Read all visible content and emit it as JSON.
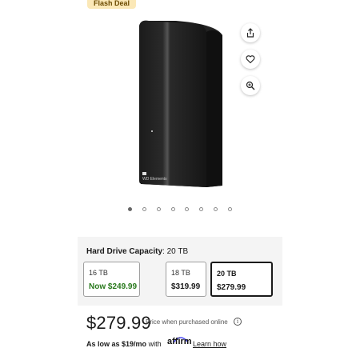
{
  "badge": {
    "label": "Flash Deal"
  },
  "product": {
    "brand_mark": "WD",
    "model_label": "WD Elements"
  },
  "actions": [
    {
      "name": "share",
      "icon": "share-icon"
    },
    {
      "name": "favorite",
      "icon": "heart-icon"
    },
    {
      "name": "zoom",
      "icon": "zoom-in-icon"
    }
  ],
  "carousel": {
    "count": 8,
    "active_index": 0
  },
  "capacity": {
    "label": "Hard Drive Capacity",
    "selected_value": "20 TB",
    "options": [
      {
        "size": "16 TB",
        "price": "Now $249.99",
        "highlight": true,
        "selected": false
      },
      {
        "size": "18 TB",
        "price": "$319.99",
        "highlight": false,
        "selected": false
      },
      {
        "size": "20 TB",
        "price": "$279.99",
        "highlight": false,
        "selected": true
      }
    ]
  },
  "pricing": {
    "price": "$279.99",
    "note": "Price when purchased online",
    "info_icon": "info-icon"
  },
  "financing": {
    "prefix": "As low as",
    "amount": "$19/mo",
    "with": "with",
    "provider": "affirm",
    "link": "Learn how"
  },
  "colors": {
    "deal_badge_bg": "#fbe8b7",
    "sale_green": "#2a7a1e",
    "selected_border": "#1a1a1a"
  }
}
